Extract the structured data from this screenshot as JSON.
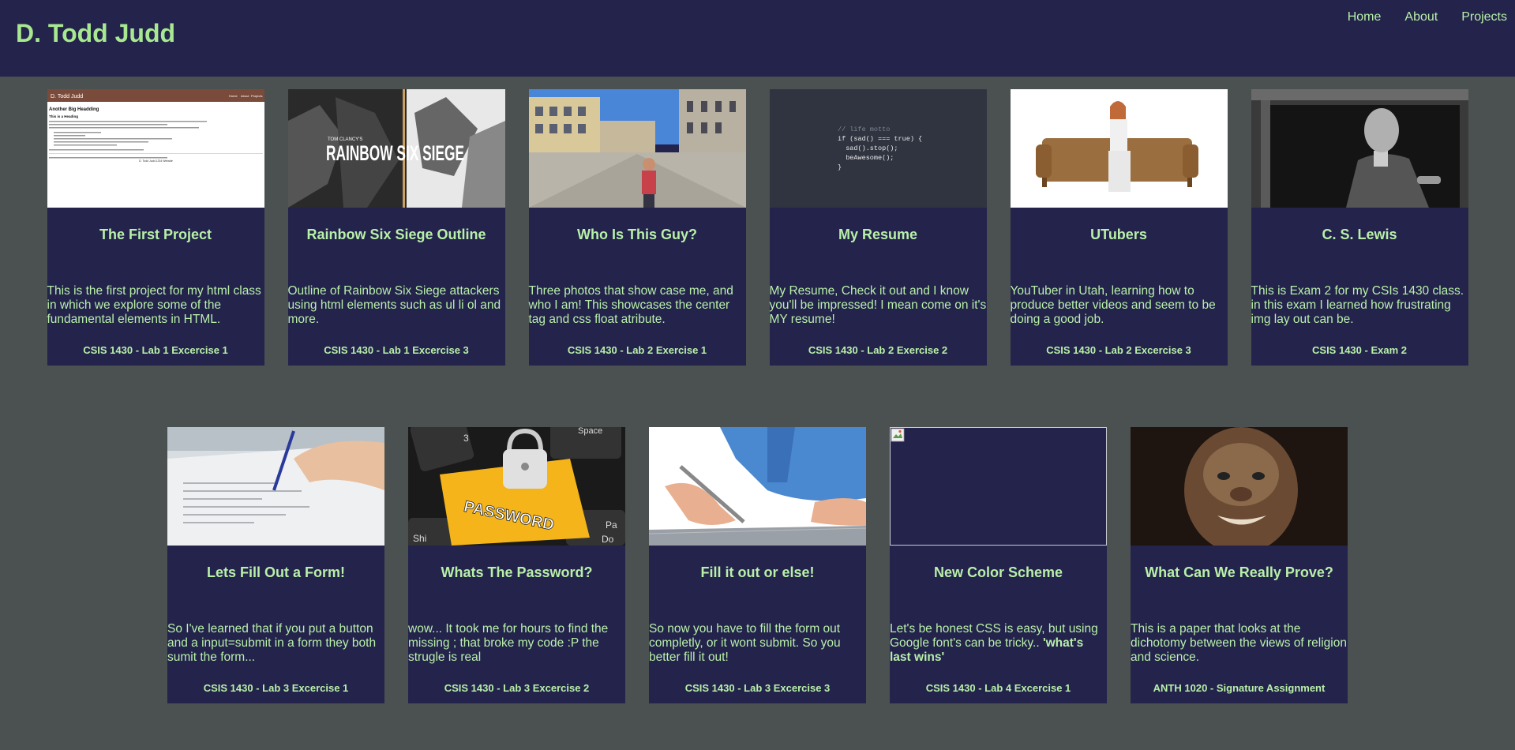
{
  "site": {
    "title": "D. Todd Judd"
  },
  "nav": {
    "home": "Home",
    "about": "About",
    "projects": "Projects"
  },
  "colors": {
    "header_bg": "#23234c",
    "page_bg": "#4b5150",
    "accent_text": "#b9f0a8"
  },
  "cards": [
    {
      "title": "The First Project",
      "desc": "This is the first project for my html class in which we explore some of the fundamental elements in HTML.",
      "course": "CSIS 1430 - Lab 1 Excercise 1",
      "thumb": {
        "kind": "webpage-screenshot",
        "header": "D. Todd Judd",
        "nav": [
          "Home",
          "About",
          "Projects"
        ],
        "heading": "Another Big Headding",
        "subheading": "This is a Heading",
        "caption": "D. Todd Judd 1234 Website"
      }
    },
    {
      "title": "Rainbow Six Siege Outline",
      "desc": "Outline of Rainbow Six Siege attackers using html elements such as ul li ol and more.",
      "course": "CSIS 1430 - Lab 1 Excercise 3",
      "thumb": {
        "kind": "game-cover",
        "small_text": "TOM CLANCY'S",
        "logo": "RAINBOW SIX SIEGE"
      }
    },
    {
      "title": "Who Is This Guy?",
      "desc": "Three photos that show case me, and who I am! This showcases the center tag and css float atribute.",
      "course": "CSIS 1430 - Lab 2 Exercise 1",
      "thumb": {
        "kind": "street-photo"
      }
    },
    {
      "title": "My Resume",
      "desc": "My Resume, Check it out and I know you'll be impressed! I mean come on it's MY resume!",
      "course": "CSIS 1430 - Lab 2 Exercise 2",
      "thumb": {
        "kind": "code-snippet",
        "lines": [
          "// life motto",
          "if (sad() === true) {",
          "  sad().stop();",
          "  beAwesome();",
          "}"
        ]
      }
    },
    {
      "title": "UTubers",
      "desc": "YouTuber in Utah, learning how to produce better videos and seem to be doing a good job.",
      "course": "CSIS 1430 - Lab 2 Excercise 3",
      "thumb": {
        "kind": "sofa-photo"
      }
    },
    {
      "title": "C. S. Lewis",
      "desc": "This is Exam 2 for my CSIs 1430 class. in this exam I learned how frustrating img lay out can be.",
      "course": "CSIS 1430 - Exam 2",
      "thumb": {
        "kind": "bw-portrait"
      }
    },
    {
      "title": "Lets Fill Out a Form!",
      "desc": "So I've learned that if you put a button and a input=submit in a form they both sumit the form...",
      "course": "CSIS 1430 - Lab 3 Excercise 1",
      "thumb": {
        "kind": "writing-photo"
      }
    },
    {
      "title": "Whats The Password?",
      "desc": "wow... It took me for hours to find the missing ; that broke my code :P the strugle is real",
      "course": "CSIS 1430 - Lab 3 Excercise 2",
      "thumb": {
        "kind": "password-key",
        "key_label": "PASSWORD",
        "other_keys": [
          "Space",
          "Shi",
          "Pa",
          "Do",
          "3"
        ]
      }
    },
    {
      "title": "Fill it out or else!",
      "desc": "So now you have to fill the form out completly, or it wont submit. So you better fill it out!",
      "course": "CSIS 1430 - Lab 3 Excercise 3",
      "thumb": {
        "kind": "signing-photo"
      }
    },
    {
      "title": "New Color Scheme",
      "desc_before": "Let's be honest CSS is easy, but using Google font's can be tricky.. ",
      "desc_bold": "'what's last wins'",
      "course": "CSIS 1430 - Lab 4 Excercise 1",
      "thumb": {
        "kind": "broken-image"
      }
    },
    {
      "title": "What Can We Really Prove?",
      "desc": "This is a paper that looks at the dichotomy between the views of religion and science.",
      "course": "ANTH 1020 - Signature Assignment",
      "thumb": {
        "kind": "hominid-photo"
      }
    }
  ]
}
